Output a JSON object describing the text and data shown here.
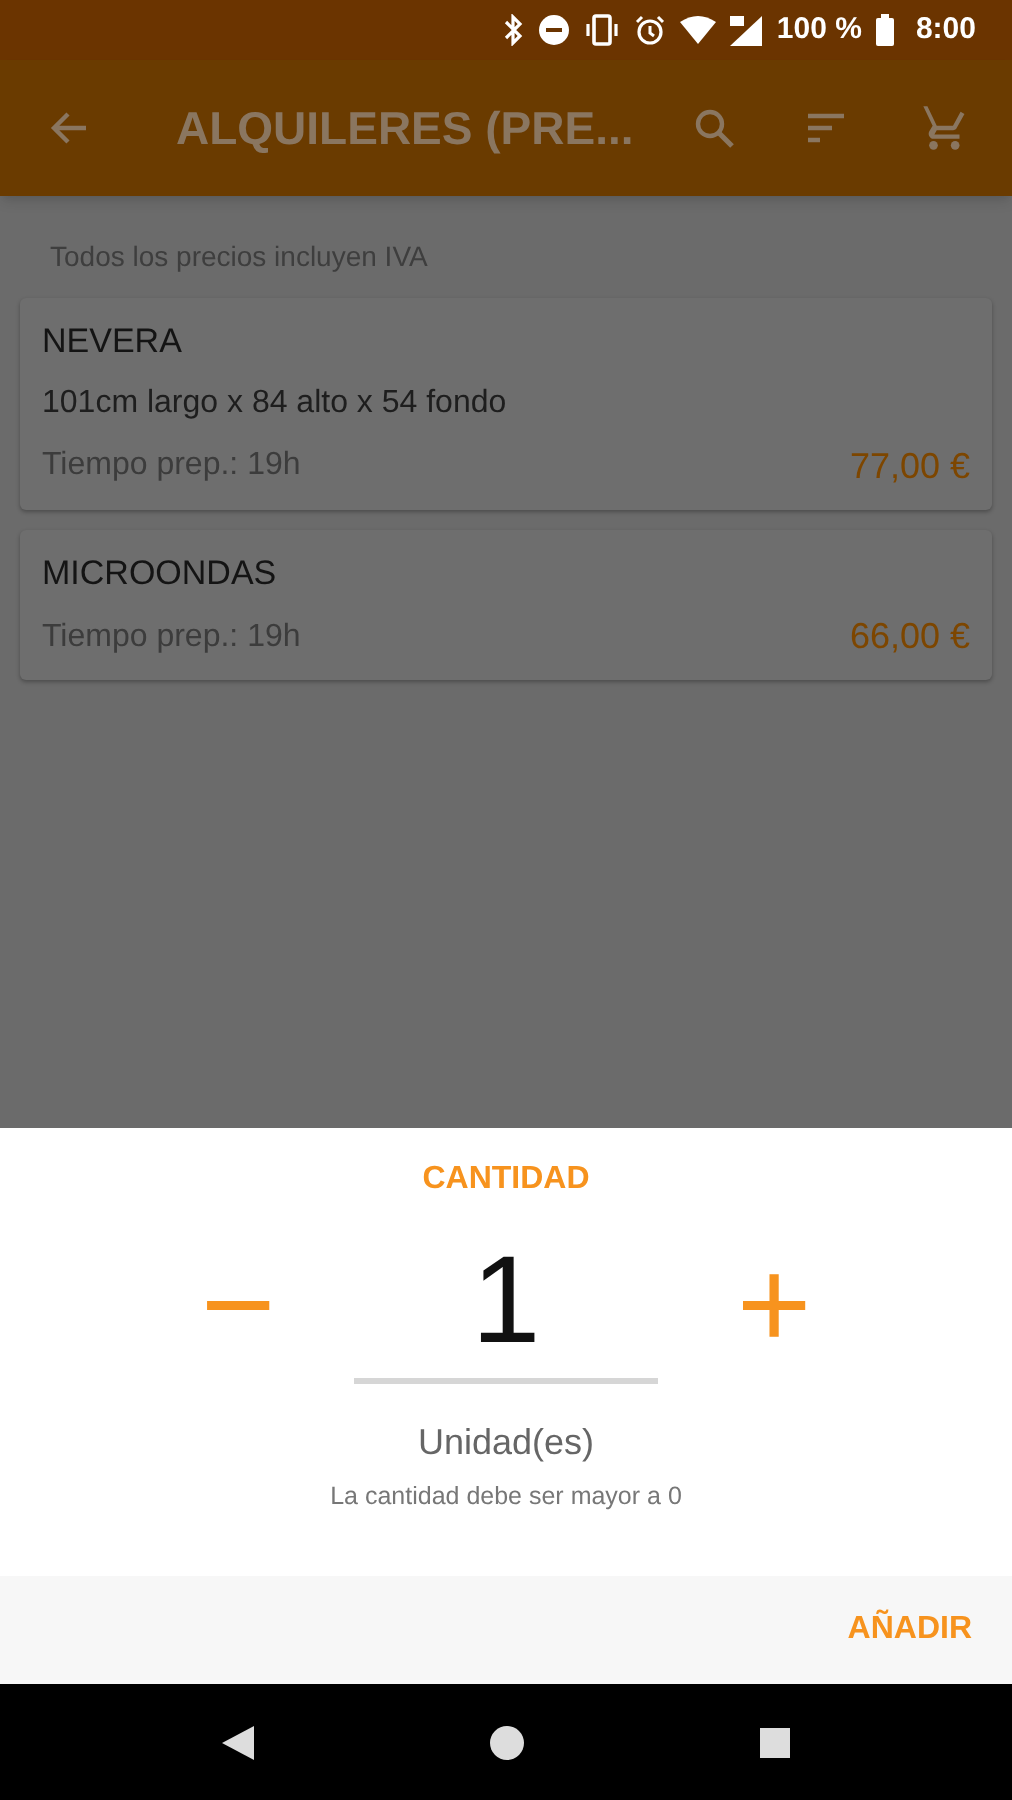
{
  "status_bar": {
    "battery": "100 %",
    "time": "8:00"
  },
  "app_bar": {
    "title": "ALQUILERES (PRE..."
  },
  "note": "Todos los precios incluyen IVA",
  "products": [
    {
      "name": "NEVERA",
      "description": "101cm largo x 84 alto x 54 fondo",
      "prep_time": "Tiempo prep.: 19h",
      "price": "77,00 €"
    },
    {
      "name": "MICROONDAS",
      "prep_time": "Tiempo prep.: 19h",
      "price": "66,00 €"
    }
  ],
  "quantity_sheet": {
    "title": "CANTIDAD",
    "decrement": "−",
    "value": "1",
    "increment": "+",
    "unit": "Unidad(es)",
    "hint": "La cantidad debe ser mayor a 0",
    "action": "AÑADIR"
  }
}
